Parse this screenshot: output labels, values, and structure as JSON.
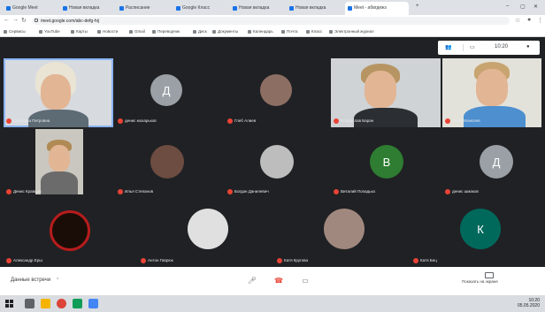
{
  "browser": {
    "tabs": [
      {
        "label": "Google Meet"
      },
      {
        "label": "Новая вкладка"
      },
      {
        "label": "Расписание"
      },
      {
        "label": "Google Класс"
      },
      {
        "label": "Новая вкладка"
      },
      {
        "label": "Новая вкладка"
      },
      {
        "label": "Meet - абвгдежз"
      }
    ],
    "url": "meet.google.com/abc-defg-hij",
    "bookmarks": [
      "Сервисы",
      "YouTube",
      "Карты",
      "Новости",
      "Gmail",
      "Переводчик",
      "Диск",
      "Документы",
      "Календарь",
      "Почта",
      "Класс",
      "Электронный журнал"
    ]
  },
  "meet": {
    "top_bar": {
      "time": "10:20"
    },
    "participants": [
      {
        "name": "Светлана Петровна",
        "kind": "video"
      },
      {
        "name": "денис мохарьков",
        "kind": "avatar",
        "initial": "Д",
        "color": "#9aa0a6"
      },
      {
        "name": "Глеб Алиев",
        "kind": "photo",
        "color": "#8d6e63"
      },
      {
        "name": "Владислав Баран",
        "kind": "video"
      },
      {
        "name": "Саша Моисеев",
        "kind": "video"
      },
      {
        "name": "Денис Кравцов",
        "kind": "video"
      },
      {
        "name": "Илья Степанов",
        "kind": "photo",
        "color": "#6d4c41"
      },
      {
        "name": "Богдан Данилевич",
        "kind": "photo",
        "color": "#bdbdbd"
      },
      {
        "name": "Виталий Попадько",
        "kind": "avatar",
        "initial": "В",
        "color": "#2e7d32"
      },
      {
        "name": "денис шмаков",
        "kind": "avatar",
        "initial": "Д",
        "color": "#9aa0a6"
      },
      {
        "name": "Александр Ерш",
        "kind": "photo",
        "color": "#b71c1c"
      },
      {
        "name": "Антон Гаврюк",
        "kind": "photo",
        "color": "#e0e0e0"
      },
      {
        "name": "Катя Кругова",
        "kind": "photo",
        "color": "#a1887f"
      },
      {
        "name": "Катя Бец",
        "kind": "avatar",
        "initial": "К",
        "color": "#00695c"
      }
    ],
    "meeting_title": "Данные встречи",
    "present_label": "Показать на экране"
  },
  "taskbar": {
    "clock_time": "10:20",
    "clock_date": "05.05.2020"
  },
  "colors": {
    "meet_bg": "#202124",
    "muted_mic": "#ea4335",
    "active_speaker": "#8ab4f8"
  }
}
